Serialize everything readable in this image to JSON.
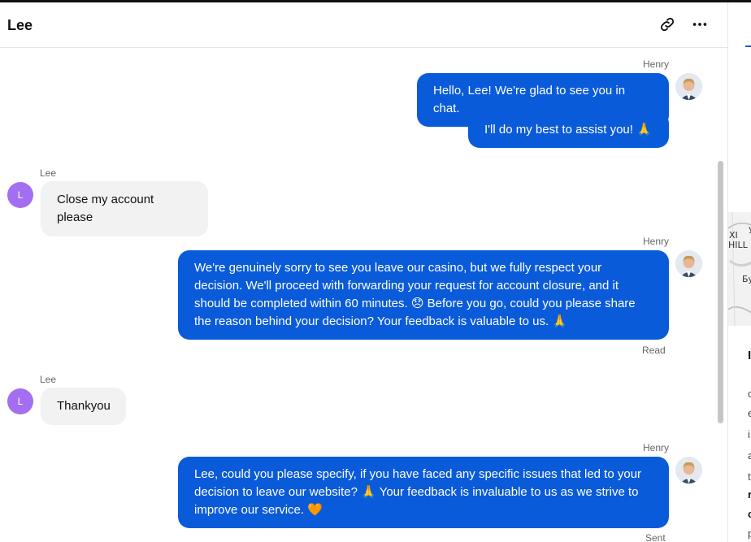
{
  "header": {
    "title": "Lee",
    "link_icon": "link-icon",
    "more_icon": "more-horizontal-icon"
  },
  "colors": {
    "outgoing_bubble": "#0a5bd9",
    "incoming_bubble": "#f2f2f2",
    "avatar_letter_bg": "#a46ef3"
  },
  "messages": {
    "m1": {
      "sender": "Henry",
      "text": "Hello, Lee! We're glad to see you in chat."
    },
    "m2": {
      "text": "I'll do my best to assist you! 🙏"
    },
    "m3": {
      "sender": "Lee",
      "avatar": "L",
      "text": "Close my account please"
    },
    "m4": {
      "sender": "Henry",
      "text": "We're genuinely sorry to see you leave our casino, but we fully respect your decision. We'll proceed with forwarding your request for account closure, and it should be completed within 60 minutes. 😞 Before you go, could you please share the reason behind your decision? Your feedback is valuable to us. 🙏",
      "status": "Read"
    },
    "m5": {
      "sender": "Lee",
      "avatar": "L",
      "text": "Thankyou"
    },
    "m6": {
      "sender": "Henry",
      "text": "Lee, could you please specify, if you have faced any specific issues that led to your decision to leave our website? 🙏 Your feedback is invaluable to us as we strive to improve our service. 🧡",
      "status": "Sent"
    }
  },
  "right_panel": {
    "map_labels": [
      "у",
      "ХІ",
      "HILL",
      "Бу"
    ],
    "letters": [
      "I",
      "c",
      "e",
      "i",
      "a",
      "t",
      "r",
      "c",
      "p"
    ]
  }
}
